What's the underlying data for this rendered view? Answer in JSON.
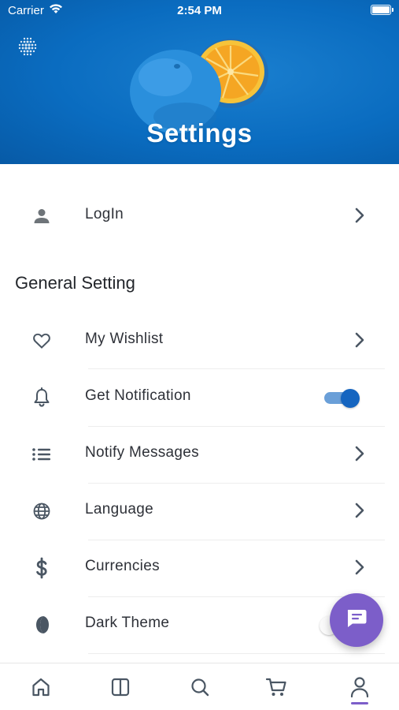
{
  "status_bar": {
    "carrier": "Carrier",
    "time": "2:54 PM"
  },
  "header": {
    "title": "Settings"
  },
  "login_row": {
    "label": "LogIn",
    "icon": "person-icon"
  },
  "section": {
    "title": "General Setting"
  },
  "settings_items": [
    {
      "label": "My Wishlist",
      "icon": "heart-icon",
      "control": "chevron"
    },
    {
      "label": "Get Notification",
      "icon": "bell-icon",
      "control": "toggle",
      "toggle_on": true
    },
    {
      "label": "Notify Messages",
      "icon": "list-icon",
      "control": "chevron"
    },
    {
      "label": "Language",
      "icon": "globe-icon",
      "control": "chevron"
    },
    {
      "label": "Currencies",
      "icon": "dollar-icon",
      "control": "chevron"
    },
    {
      "label": "Dark Theme",
      "icon": "moon-icon",
      "control": "toggle",
      "toggle_on": false
    }
  ],
  "bottom_nav": {
    "items": [
      "home-icon",
      "category-icon",
      "search-icon",
      "cart-icon",
      "profile-icon"
    ],
    "active": "profile-icon"
  },
  "colors": {
    "header_blue": "#0a6cc0",
    "accent_purple": "#7c5ec9",
    "toggle_blue": "#1565c0"
  }
}
